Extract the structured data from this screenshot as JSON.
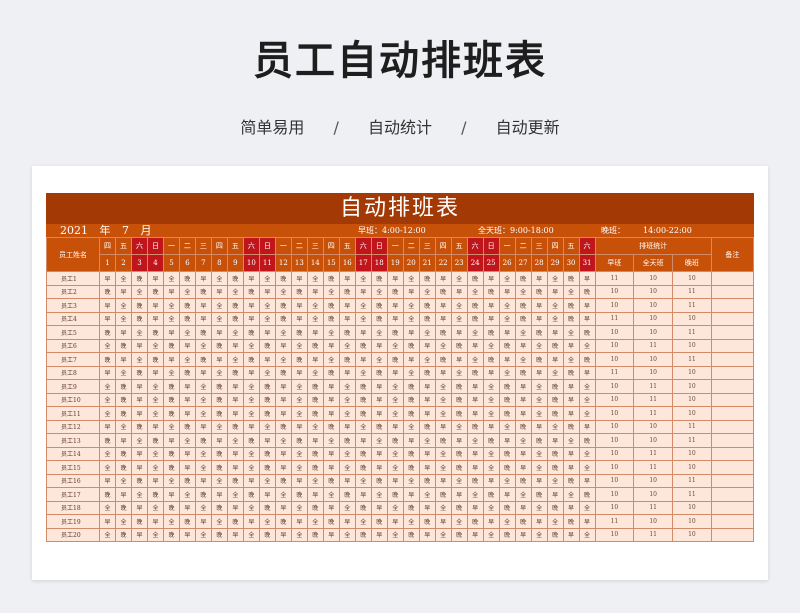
{
  "page": {
    "title": "员工自动排班表",
    "tags": [
      "简单易用",
      "自动统计",
      "自动更新"
    ],
    "separator": "/"
  },
  "sheet": {
    "banner": "自动排班表",
    "year": "2021",
    "year_unit": "年",
    "month": "7",
    "month_unit": "月",
    "shifts": [
      {
        "label": "早班：",
        "time": "4:00-12:00"
      },
      {
        "label": "全天班：",
        "time": "9:00-18:00"
      },
      {
        "label": "晚班：",
        "time": "14:00-22:00"
      }
    ],
    "name_header": "员工姓名",
    "stats_header": "排班统计",
    "stat_cols": [
      "早班",
      "全天班",
      "晚班"
    ],
    "remark_header": "备注",
    "weekdays": [
      "四",
      "五",
      "六",
      "日",
      "一",
      "二",
      "三",
      "四",
      "五",
      "六",
      "日",
      "一",
      "二",
      "三",
      "四",
      "五",
      "六",
      "日",
      "一",
      "二",
      "三",
      "四",
      "五",
      "六",
      "日",
      "一",
      "二",
      "三",
      "四",
      "五",
      "六"
    ],
    "dates": [
      "1",
      "2",
      "3",
      "4",
      "5",
      "6",
      "7",
      "8",
      "9",
      "10",
      "11",
      "12",
      "13",
      "14",
      "15",
      "16",
      "17",
      "18",
      "19",
      "20",
      "21",
      "22",
      "23",
      "24",
      "25",
      "26",
      "27",
      "28",
      "29",
      "30",
      "31"
    ],
    "weekend_color": "#c0161b",
    "header_color": "#c8510a",
    "banner_color": "#a33a05",
    "row_color": "#fde6da"
  },
  "employees": [
    {
      "name": "员工1",
      "shifts": "早全晚早全晚早全晚早全晚早全晚早全晚早全晚早全晚早全晚早全晚早全晚早",
      "stats": [
        "11",
        "10",
        "10"
      ]
    },
    {
      "name": "员工2",
      "shifts": "晚早全晚早全晚早全晚早全晚早全晚早全晚早全晚早全晚早全晚早全晚早全",
      "stats": [
        "10",
        "10",
        "11"
      ]
    },
    {
      "name": "员工3",
      "shifts": "早全晚早全晚早全晚早全晚早全晚早全晚早全晚早全晚早全晚早全晚早全晚",
      "stats": [
        "10",
        "10",
        "11"
      ]
    },
    {
      "name": "员工4",
      "shifts": "早全晚早全晚早全晚早全晚早全晚早全晚早全晚早全晚早全晚早全晚早全晚早",
      "stats": [
        "11",
        "10",
        "10"
      ]
    },
    {
      "name": "员工5",
      "shifts": "晚早全晚早全晚早全晚早全晚早全晚早全晚早全晚早全晚早全晚早全晚早全",
      "stats": [
        "10",
        "10",
        "11"
      ]
    },
    {
      "name": "员工6",
      "shifts": "全晚早全晚早全晚早全晚早全晚早全晚早全晚早全晚早全晚早全晚早全晚早全",
      "stats": [
        "10",
        "11",
        "10"
      ]
    },
    {
      "name": "员工7",
      "shifts": "晚早全晚早全晚早全晚早全晚早全晚早全晚早全晚早全晚早全晚早全晚早全晚",
      "stats": [
        "10",
        "10",
        "11"
      ]
    },
    {
      "name": "员工8",
      "shifts": "早全晚早全晚早全晚早全晚早全晚早全晚早全晚早全晚早全晚早全晚早全晚早",
      "stats": [
        "11",
        "10",
        "10"
      ]
    },
    {
      "name": "员工9",
      "shifts": "全晚早全晚早全晚早全晚早全晚早全晚早全晚早全晚早全晚早全晚早全晚早全",
      "stats": [
        "10",
        "11",
        "10"
      ]
    },
    {
      "name": "员工10",
      "shifts": "全晚早全晚早全晚早全晚早全晚早全晚早全晚早全晚早全晚早全晚早全晚早全",
      "stats": [
        "10",
        "11",
        "10"
      ]
    },
    {
      "name": "员工11",
      "shifts": "全晚早全晚早全晚早全晚早全晚早全晚早全晚早全晚早全晚早全晚早全晚早全",
      "stats": [
        "10",
        "11",
        "10"
      ]
    },
    {
      "name": "员工12",
      "shifts": "早全晚早全晚早全晚早全晚早全晚早全晚早全晚早全晚早全晚早全晚早全晚早",
      "stats": [
        "10",
        "10",
        "11"
      ]
    },
    {
      "name": "员工13",
      "shifts": "晚早全晚早全晚早全晚早全晚早全晚早全晚早全晚早全晚早全晚早全晚早全晚",
      "stats": [
        "10",
        "10",
        "11"
      ]
    },
    {
      "name": "员工14",
      "shifts": "全晚早全晚早全晚早全晚早全晚早全晚早全晚早全晚早全晚早全晚早全晚早全",
      "stats": [
        "10",
        "11",
        "10"
      ]
    },
    {
      "name": "员工15",
      "shifts": "全晚早全晚早全晚早全晚早全晚早全晚早全晚早全晚早全晚早全晚早全晚早全",
      "stats": [
        "10",
        "11",
        "10"
      ]
    },
    {
      "name": "员工16",
      "shifts": "早全晚早全晚早全晚早全晚早全晚早全晚早全晚早全晚早全晚早全晚早全晚早",
      "stats": [
        "10",
        "10",
        "11"
      ]
    },
    {
      "name": "员工17",
      "shifts": "晚早全晚早全晚早全晚早全晚早全晚早全晚早全晚早全晚早全晚早全晚早全晚",
      "stats": [
        "10",
        "10",
        "11"
      ]
    },
    {
      "name": "员工18",
      "shifts": "全晚早全晚早全晚早全晚早全晚早全晚早全晚早全晚早全晚早全晚早全晚早全",
      "stats": [
        "10",
        "11",
        "10"
      ]
    },
    {
      "name": "员工19",
      "shifts": "早全晚早全晚早全晚早全晚早全晚早全晚早全晚早全晚早全晚早全晚早全晚早",
      "stats": [
        "11",
        "10",
        "10"
      ]
    },
    {
      "name": "员工20",
      "shifts": "全晚早全晚早全晚早全晚早全晚早全晚早全晚早全晚早全晚早全晚早全晚早全",
      "stats": [
        "10",
        "11",
        "10"
      ]
    }
  ]
}
